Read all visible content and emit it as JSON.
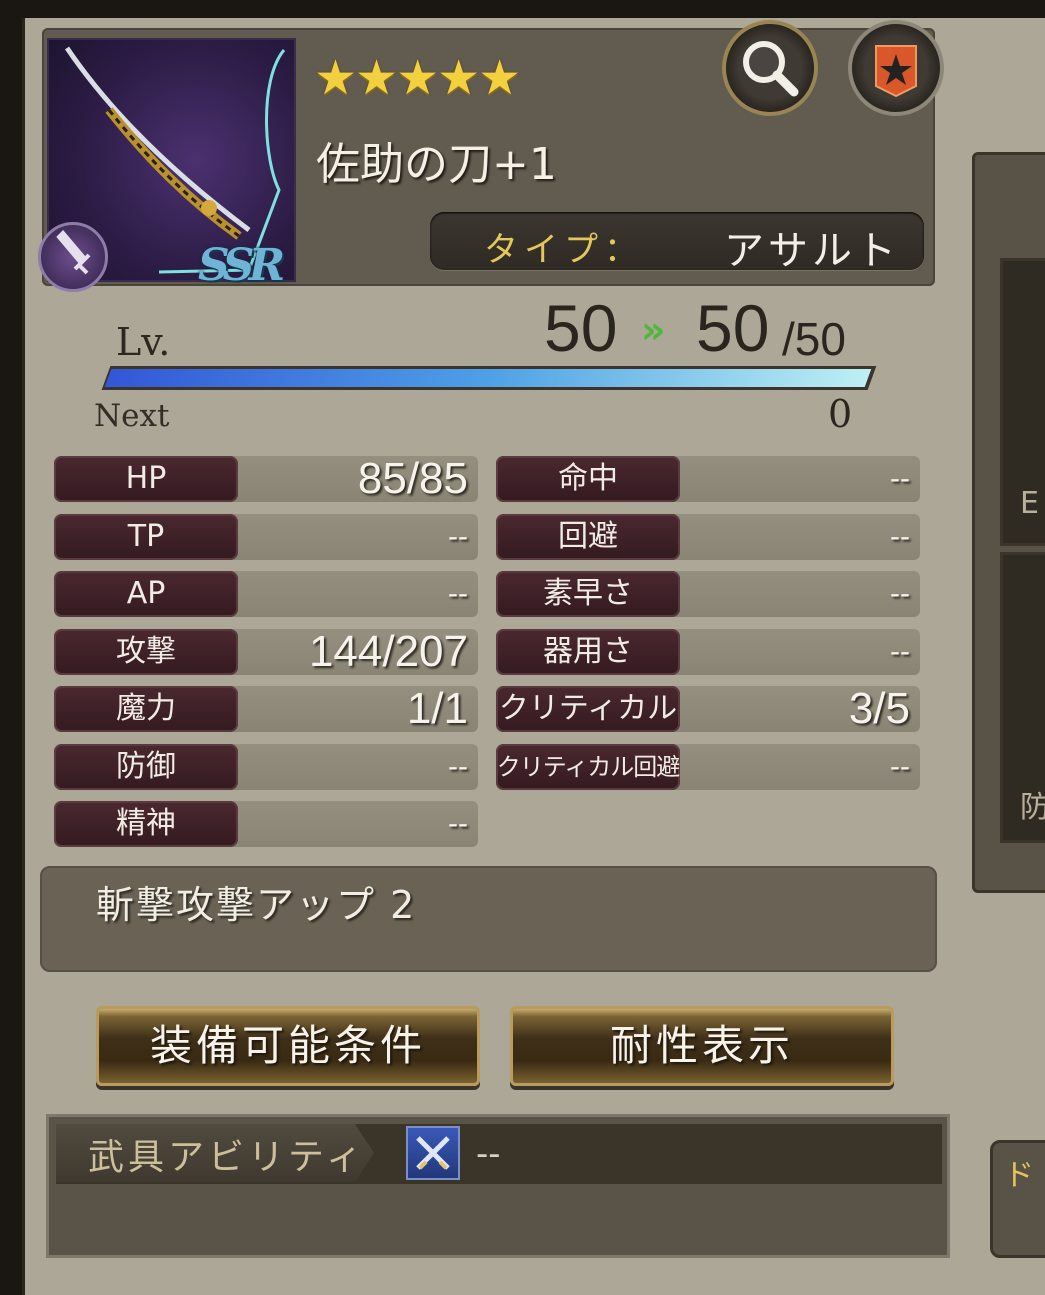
{
  "weapon": {
    "rarity_stars": "★★★★★",
    "name": "佐助の刀+1",
    "rarity": "SSR",
    "type_label": "タイプ：",
    "type_value": "アサルト"
  },
  "level": {
    "label": "Lv.",
    "current": "50",
    "arrow": "»",
    "new": "50",
    "max": "/50",
    "exp_fill_fraction": 1.0,
    "next_label": "Next",
    "next_value": "0"
  },
  "stats_left": [
    {
      "label": "HP",
      "value": "85/85"
    },
    {
      "label": "TP",
      "value": "--"
    },
    {
      "label": "AP",
      "value": "--"
    },
    {
      "label": "攻撃",
      "value": "144/207"
    },
    {
      "label": "魔力",
      "value": "1/1"
    },
    {
      "label": "防御",
      "value": "--"
    },
    {
      "label": "精神",
      "value": "--"
    }
  ],
  "stats_right": [
    {
      "label": "命中",
      "value": "--"
    },
    {
      "label": "回避",
      "value": "--"
    },
    {
      "label": "素早さ",
      "value": "--"
    },
    {
      "label": "器用さ",
      "value": "--"
    },
    {
      "label": "クリティカル",
      "value": "3/5"
    },
    {
      "label": "クリティカル回避",
      "value": "--"
    }
  ],
  "description": "斬撃攻撃アップ 2",
  "buttons": {
    "equip_conditions": "装備可能条件",
    "resistance": "耐性表示"
  },
  "ability": {
    "tab_label": "武具アビリティ",
    "value": "--"
  },
  "side": {
    "label_e": "E",
    "label_def": "防",
    "label_do": "ド"
  },
  "icons": {
    "search": "search-icon",
    "favorite": "star-badge-icon",
    "weapon_type": "sword-icon",
    "ability": "crossed-swords-icon"
  }
}
